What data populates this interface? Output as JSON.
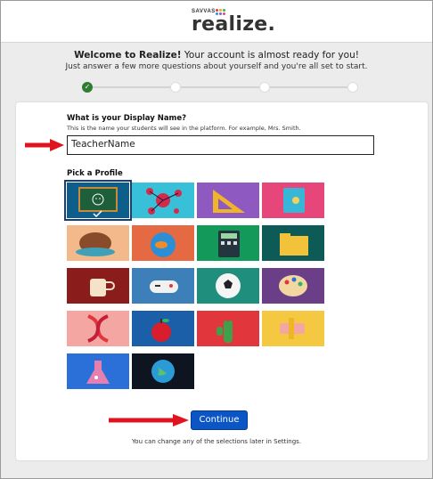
{
  "header": {
    "brand_small": "SAVVAS",
    "brand_word": "realize.",
    "brand_colors": [
      "#e2363d",
      "#f6a623",
      "#2bb673",
      "#1e90ff"
    ]
  },
  "welcome": {
    "line1_bold": "Welcome to Realize!",
    "line1_rest": " Your account is almost ready for you!",
    "line2": "Just answer a few more questions about yourself and you're all set to start."
  },
  "stepper": {
    "steps": 4,
    "completed": 1
  },
  "display_name": {
    "title": "What is your Display Name?",
    "help": "This is the name your students will see in the platform. For example, Mrs. Smith.",
    "value": "TeacherName"
  },
  "profile": {
    "title": "Pick a Profile",
    "selected_index": 0,
    "avatars": [
      {
        "name": "chalkboard-smiley",
        "bg": "#0d5e8a"
      },
      {
        "name": "molecule",
        "bg": "#37c0d8"
      },
      {
        "name": "set-square",
        "bg": "#8e5ac2"
      },
      {
        "name": "notebook",
        "bg": "#e6467a"
      },
      {
        "name": "turtle",
        "bg": "#f3b98a"
      },
      {
        "name": "fishbowl",
        "bg": "#e56a44"
      },
      {
        "name": "calculator",
        "bg": "#139a5a"
      },
      {
        "name": "folder",
        "bg": "#0e5a57"
      },
      {
        "name": "coffee-cup",
        "bg": "#8b1c1c"
      },
      {
        "name": "game-controller",
        "bg": "#3d7fb8"
      },
      {
        "name": "soccer-ball",
        "bg": "#1f8e7c"
      },
      {
        "name": "paint-palette",
        "bg": "#6a3f88"
      },
      {
        "name": "dna",
        "bg": "#f4a7a2"
      },
      {
        "name": "apple",
        "bg": "#1b5fa8"
      },
      {
        "name": "cactus",
        "bg": "#e2363d"
      },
      {
        "name": "pencil-eraser",
        "bg": "#f5c842"
      },
      {
        "name": "flask",
        "bg": "#2b6fd8"
      },
      {
        "name": "globe",
        "bg": "#0e1520"
      }
    ]
  },
  "actions": {
    "continue_label": "Continue",
    "footer_note": "You can change any of the selections later in Settings."
  },
  "annotation_color": "#e0141f"
}
